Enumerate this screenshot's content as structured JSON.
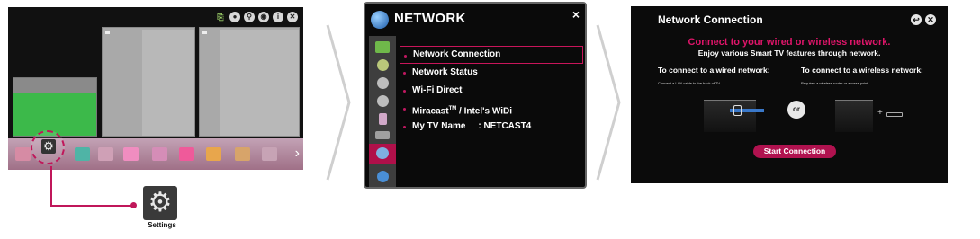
{
  "home": {
    "top_icons": [
      "input-icon",
      "search-icon",
      "magnifier-icon",
      "record-icon",
      "info-icon",
      "close-icon"
    ],
    "dock_apps": [
      {
        "color": "#d68ba4"
      },
      {
        "color": "#4fb4a6"
      },
      {
        "color": "#cfa0b6"
      },
      {
        "color": "#f08dc0"
      },
      {
        "color": "#d58db7"
      },
      {
        "color": "#ef5a9a"
      },
      {
        "color": "#e8a64c"
      },
      {
        "color": "#d7a46a"
      },
      {
        "color": "#c7a3b5"
      }
    ],
    "settings_callout_label": "Settings"
  },
  "network_menu": {
    "title": "NETWORK",
    "close": "×",
    "items": [
      {
        "label": "Network Connection",
        "selected": true
      },
      {
        "label": "Network Status",
        "selected": false
      },
      {
        "label": "Wi-Fi Direct",
        "selected": false
      },
      {
        "label_main": "Miracast",
        "label_sup": "TM",
        "label_rest": " / Intel's WiDi",
        "selected": false
      },
      {
        "label": "My TV Name     : NETCAST4",
        "selected": false
      }
    ]
  },
  "connection": {
    "title": "Network Connection",
    "headline": "Connect to your wired or wireless network.",
    "subline": "Enjoy various Smart TV features through network.",
    "wired_heading": "To connect to a wired network:",
    "wired_note": "Connect a LAN cable to the back of TV.",
    "wireless_heading": "To connect to a wireless network:",
    "wireless_note": "Requires a wireless router or access point.",
    "or_label": "or",
    "start_button": "Start Connection"
  },
  "colors": {
    "accent": "#c0175a",
    "headline_pink": "#e0156a",
    "panel_bg": "#0b0b0b"
  }
}
